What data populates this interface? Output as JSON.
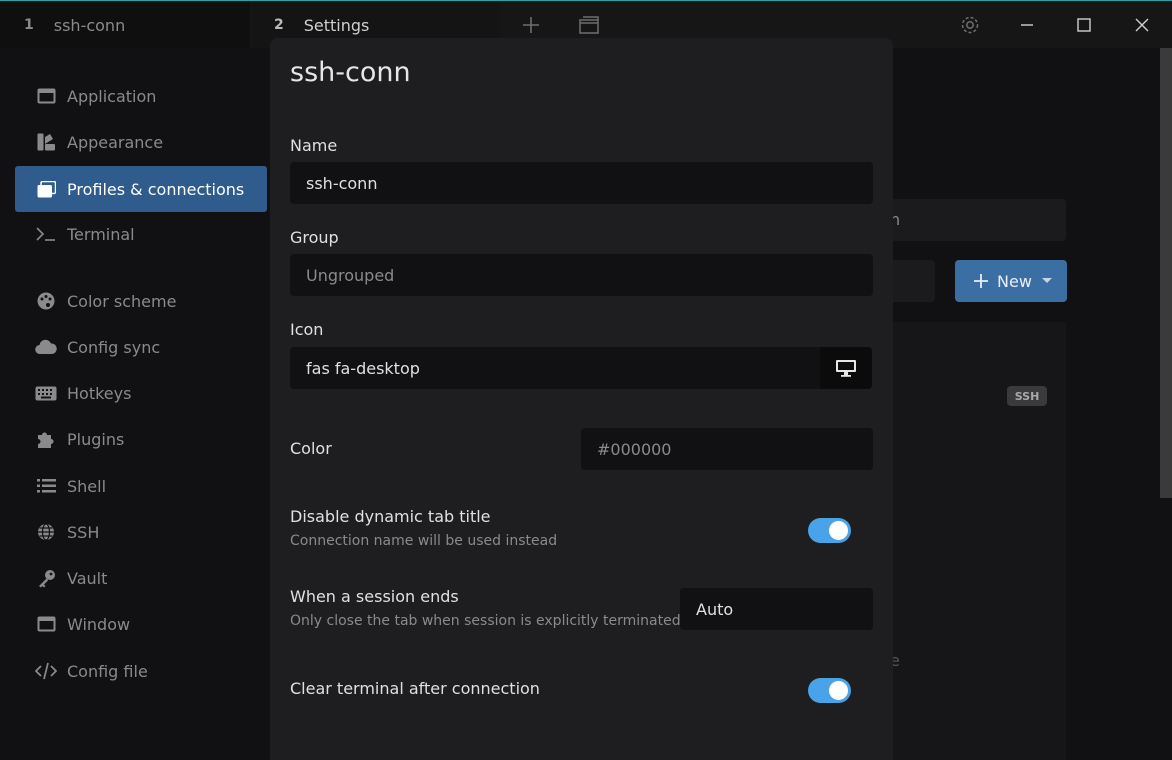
{
  "tabs": [
    {
      "num": "1",
      "label": "ssh-conn"
    },
    {
      "num": "2",
      "label": "Settings"
    }
  ],
  "titlebar_icons": [
    "plus-icon",
    "windows-icon",
    "gear-icon",
    "minimize-icon",
    "maximize-icon",
    "close-icon"
  ],
  "sidebar": {
    "items": [
      {
        "label": "Application",
        "icon": "window-icon"
      },
      {
        "label": "Appearance",
        "icon": "swatchbook-icon"
      },
      {
        "label": "Profiles & connections",
        "icon": "window-restore-icon",
        "active": true
      },
      {
        "label": "Terminal",
        "icon": "terminal-icon"
      },
      {
        "label": "Color scheme",
        "icon": "palette-icon"
      },
      {
        "label": "Config sync",
        "icon": "cloud-icon"
      },
      {
        "label": "Hotkeys",
        "icon": "keyboard-icon"
      },
      {
        "label": "Plugins",
        "icon": "puzzle-icon"
      },
      {
        "label": "Shell",
        "icon": "list-icon"
      },
      {
        "label": "SSH",
        "icon": "globe-icon"
      },
      {
        "label": "Vault",
        "icon": "key-icon"
      },
      {
        "label": "Window",
        "icon": "window-icon"
      },
      {
        "label": "Config file",
        "icon": "code-icon"
      }
    ]
  },
  "background": {
    "search_fragment": "n",
    "new_button": "New",
    "badge": "SSH",
    "fragment_e": "e"
  },
  "modal": {
    "title": "ssh-conn",
    "name_label": "Name",
    "name_value": "ssh-conn",
    "group_label": "Group",
    "group_placeholder": "Ungrouped",
    "icon_label": "Icon",
    "icon_value": "fas fa-desktop",
    "color_label": "Color",
    "color_placeholder": "#000000",
    "dynamic_title_label": "Disable dynamic tab title",
    "dynamic_title_desc": "Connection name will be used instead",
    "dynamic_title_on": true,
    "session_end_label": "When a session ends",
    "session_end_desc": "Only close the tab when session is explicitly terminated",
    "session_end_value": "Auto",
    "clear_terminal_label": "Clear terminal after connection",
    "clear_terminal_on": true
  },
  "colors": {
    "accent": "#2f5c8c",
    "toggle": "#4aa3e8",
    "modal_bg": "#1e1e20"
  }
}
